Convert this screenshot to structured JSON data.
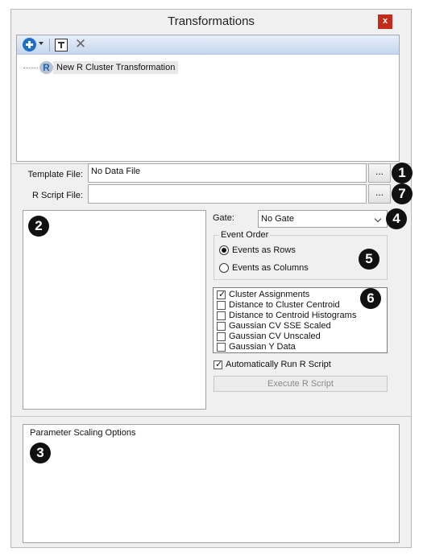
{
  "window": {
    "title": "Transformations",
    "close_label": "x"
  },
  "tree": {
    "items": [
      {
        "label": "New R Cluster Transformation",
        "icon": "r-logo-icon"
      }
    ]
  },
  "template_file": {
    "label": "Template File:",
    "value": "No Data File",
    "browse_label": "...",
    "badge": "1"
  },
  "r_script_file": {
    "label": "R Script File:",
    "value": "",
    "browse_label": "...",
    "badge": "7"
  },
  "left_panel": {
    "badge": "2"
  },
  "gate": {
    "label": "Gate:",
    "selected": "No Gate",
    "badge": "4"
  },
  "event_order": {
    "legend": "Event Order",
    "options": [
      {
        "label": "Events as Rows",
        "selected": true
      },
      {
        "label": "Events as Columns",
        "selected": false
      }
    ],
    "badge": "5"
  },
  "outputs": {
    "items": [
      {
        "label": "Cluster Assignments",
        "checked": true
      },
      {
        "label": "Distance to Cluster Centroid",
        "checked": false
      },
      {
        "label": "Distance to Centroid Histograms",
        "checked": false
      },
      {
        "label": "Gaussian CV SSE Scaled",
        "checked": false
      },
      {
        "label": "Gaussian CV Unscaled",
        "checked": false
      },
      {
        "label": "Gaussian Y Data",
        "checked": false
      }
    ],
    "badge": "6"
  },
  "auto_run": {
    "label": "Automatically Run R Script",
    "checked": true
  },
  "execute": {
    "label": "Execute R Script"
  },
  "parameter_scaling": {
    "title": "Parameter Scaling Options",
    "badge": "3"
  },
  "colors": {
    "close": "#c42b1c",
    "toolbar": "#c6d6ee",
    "badge": "#111111",
    "add": "#1f6fc9"
  }
}
